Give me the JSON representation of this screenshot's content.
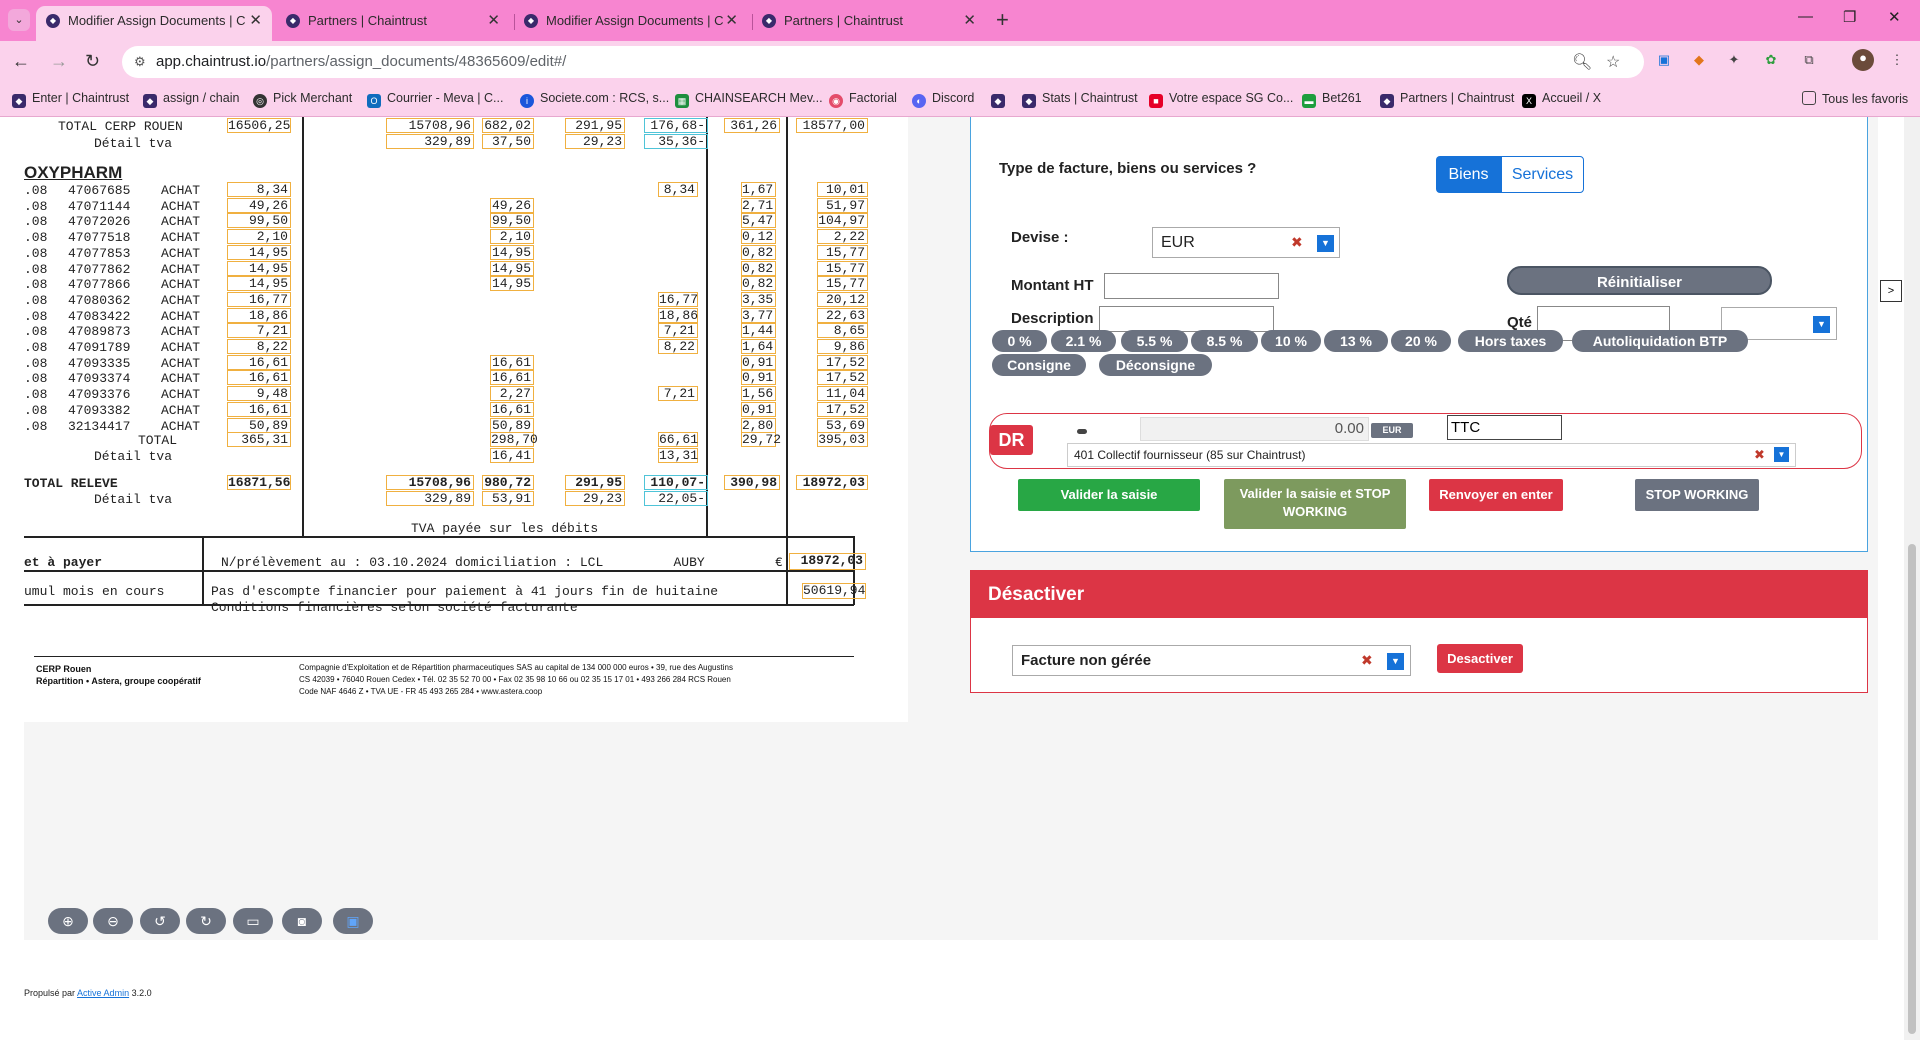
{
  "browser": {
    "tabs": [
      {
        "title": "Modifier Assign Documents | C",
        "active": true
      },
      {
        "title": "Partners | Chaintrust",
        "active": false
      },
      {
        "title": "Modifier Assign Documents | C",
        "active": false
      },
      {
        "title": "Partners | Chaintrust",
        "active": false
      }
    ],
    "url_host": "app.chaintrust.io",
    "url_path": "/partners/assign_documents/48365609/edit#/",
    "bookmarks": [
      "Enter | Chaintrust",
      "assign / chain",
      "Pick Merchant",
      "Courrier - Meva | C...",
      "Societe.com : RCS, s...",
      "CHAINSEARCH Mev...",
      "Factorial",
      "Discord",
      "Stats | Chaintrust",
      "Votre espace SG Co...",
      "Bet261",
      "Partners | Chaintrust",
      "Accueil / X"
    ],
    "all_bookmarks": "Tous les favoris"
  },
  "document": {
    "total_cerp_label": "TOTAL CERP ROUEN",
    "total_cerp_values": [
      "16506,25",
      "15708,96",
      "682,02",
      "291,95",
      "176,68-",
      "361,26",
      "18577,00"
    ],
    "detail_tva_label": "Détail tva",
    "detail_tva_values": [
      "329,89",
      "37,50",
      "29,23",
      "35,36-"
    ],
    "supplier": "OXYPHARM",
    "rows": [
      {
        "date": ".08",
        "ref": "47067685",
        "type": "ACHAT",
        "amt": "8,34",
        "c2": "",
        "c5": "8,34",
        "tva": "1,67",
        "ttc": "10,01"
      },
      {
        "date": ".08",
        "ref": "47071144",
        "type": "ACHAT",
        "amt": "49,26",
        "c2": "49,26",
        "c5": "",
        "tva": "2,71",
        "ttc": "51,97"
      },
      {
        "date": ".08",
        "ref": "47072026",
        "type": "ACHAT",
        "amt": "99,50",
        "c2": "99,50",
        "c5": "",
        "tva": "5,47",
        "ttc": "104,97"
      },
      {
        "date": ".08",
        "ref": "47077518",
        "type": "ACHAT",
        "amt": "2,10",
        "c2": "2,10",
        "c5": "",
        "tva": "0,12",
        "ttc": "2,22"
      },
      {
        "date": ".08",
        "ref": "47077853",
        "type": "ACHAT",
        "amt": "14,95",
        "c2": "14,95",
        "c5": "",
        "tva": "0,82",
        "ttc": "15,77"
      },
      {
        "date": ".08",
        "ref": "47077862",
        "type": "ACHAT",
        "amt": "14,95",
        "c2": "14,95",
        "c5": "",
        "tva": "0,82",
        "ttc": "15,77"
      },
      {
        "date": ".08",
        "ref": "47077866",
        "type": "ACHAT",
        "amt": "14,95",
        "c2": "14,95",
        "c5": "",
        "tva": "0,82",
        "ttc": "15,77"
      },
      {
        "date": ".08",
        "ref": "47080362",
        "type": "ACHAT",
        "amt": "16,77",
        "c2": "",
        "c5": "16,77",
        "tva": "3,35",
        "ttc": "20,12"
      },
      {
        "date": ".08",
        "ref": "47083422",
        "type": "ACHAT",
        "amt": "18,86",
        "c2": "",
        "c5": "18,86",
        "tva": "3,77",
        "ttc": "22,63"
      },
      {
        "date": ".08",
        "ref": "47089873",
        "type": "ACHAT",
        "amt": "7,21",
        "c2": "",
        "c5": "7,21",
        "tva": "1,44",
        "ttc": "8,65"
      },
      {
        "date": ".08",
        "ref": "47091789",
        "type": "ACHAT",
        "amt": "8,22",
        "c2": "",
        "c5": "8,22",
        "tva": "1,64",
        "ttc": "9,86"
      },
      {
        "date": ".08",
        "ref": "47093335",
        "type": "ACHAT",
        "amt": "16,61",
        "c2": "16,61",
        "c5": "",
        "tva": "0,91",
        "ttc": "17,52"
      },
      {
        "date": ".08",
        "ref": "47093374",
        "type": "ACHAT",
        "amt": "16,61",
        "c2": "16,61",
        "c5": "",
        "tva": "0,91",
        "ttc": "17,52"
      },
      {
        "date": ".08",
        "ref": "47093376",
        "type": "ACHAT",
        "amt": "9,48",
        "c2": "2,27",
        "c5": "7,21",
        "tva": "1,56",
        "ttc": "11,04"
      },
      {
        "date": ".08",
        "ref": "47093382",
        "type": "ACHAT",
        "amt": "16,61",
        "c2": "16,61",
        "c5": "",
        "tva": "0,91",
        "ttc": "17,52"
      },
      {
        "date": ".08",
        "ref": "32134417",
        "type": "ACHAT",
        "amt": "50,89",
        "c2": "50,89",
        "c5": "",
        "tva": "2,80",
        "ttc": "53,69"
      }
    ],
    "total_label": "TOTAL",
    "total_values": [
      "365,31",
      "298,70",
      "66,61",
      "29,72",
      "395,03"
    ],
    "total_detail_tva": [
      "16,41",
      "13,31"
    ],
    "total_releve_label": "TOTAL RELEVE",
    "total_releve_values": [
      "16871,56",
      "15708,96",
      "980,72",
      "291,95",
      "110,07-",
      "390,98",
      "18972,03"
    ],
    "total_releve_tva": [
      "329,89",
      "53,91",
      "29,23",
      "22,05-"
    ],
    "tva_debits": "TVA payée sur les débits",
    "net_a_payer": "et à payer",
    "prelevement": "N/prélèvement au : 03.10.2024 domiciliation : LCL         AUBY",
    "currency_sign": "€",
    "net_value": "18972,03",
    "cumul": "umul mois en cours",
    "escompte1": "Pas d'escompte financier pour paiement à 41 jours fin de huitaine",
    "escompte2": "Conditions financières selon société facturante",
    "cumul_value": "50619,94",
    "footer_left1": "CERP Rouen",
    "footer_left2": "Répartition • Astera, groupe coopératif",
    "footer_right1": "Compagnie d'Exploitation et de Répartition pharmaceutiques SAS au capital de 134 000 000 euros • 39, rue des Augustins",
    "footer_right2": "CS 42039 • 76040 Rouen Cedex • Tél. 02 35 52 70 00 • Fax 02 35 98 10 66 ou 02 35 15 17 01 • 493 266 284 RCS Rouen",
    "footer_right3": "Code NAF 4646 Z • TVA UE - FR 45 493 265 284 • www.astera.coop"
  },
  "form": {
    "type_question": "Type de facture, biens ou services ?",
    "biens": "Biens",
    "services": "Services",
    "devise_label": "Devise :",
    "devise_value": "EUR",
    "montant_label": "Montant HT",
    "description_label": "Description",
    "reinit": "Réinitialiser",
    "qte_label": "Qté",
    "rates": [
      "0 %",
      "2.1 %",
      "5.5 %",
      "8.5 %",
      "10 %",
      "13 %",
      "20 %",
      "Hors taxes",
      "Autoliquidation BTP",
      "Consigne",
      "Déconsigne"
    ],
    "dr_badge": "DR",
    "amount_value": "0.00",
    "amount_currency": "EUR",
    "ttc_value": "TTC",
    "account": "401 Collectif fournisseur (85 sur Chaintrust)",
    "btn_valider": "Valider la saisie",
    "btn_valider_stop": "Valider la saisie et STOP WORKING",
    "btn_renvoyer": "Renvoyer en enter",
    "btn_stop": "STOP WORKING"
  },
  "desactiver": {
    "title": "Désactiver",
    "select_value": "Facture non gérée",
    "button": "Desactiver"
  },
  "footer": {
    "powered_prefix": "Propulsé par",
    "powered_link": "Active Admin",
    "powered_version": "3.2.0"
  }
}
